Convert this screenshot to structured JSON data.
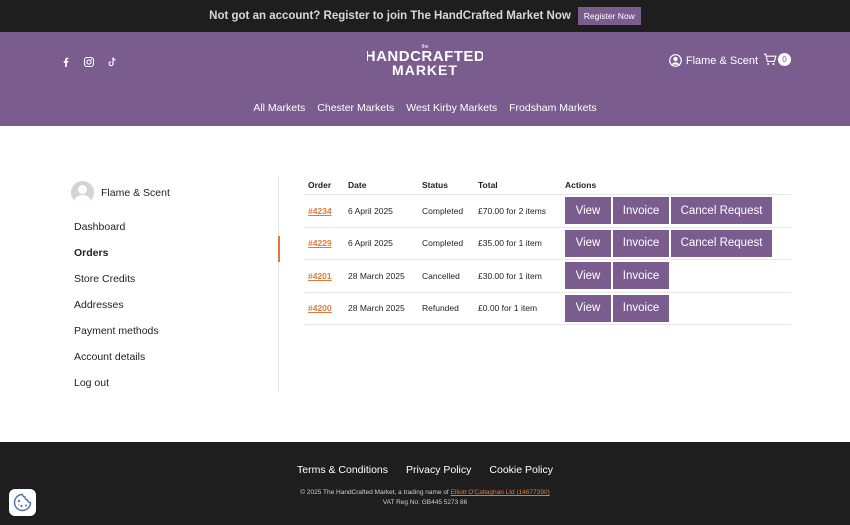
{
  "topbar": {
    "message": "Not got an account? Register to join The HandCrafted Market Now",
    "button": "Register Now"
  },
  "header": {
    "social_icons": [
      "facebook-icon",
      "instagram-icon",
      "tiktok-icon"
    ],
    "logo_alt": "The HandCrafted Market",
    "account_name": "Flame & Scent",
    "cart_count": "0",
    "nav": [
      "All Markets",
      "Chester Markets",
      "West Kirby Markets",
      "Frodsham Markets"
    ]
  },
  "sidebar": {
    "user_name": "Flame & Scent",
    "items": [
      "Dashboard",
      "Orders",
      "Store Credits",
      "Addresses",
      "Payment methods",
      "Account details",
      "Log out"
    ],
    "active": "Orders"
  },
  "orders": {
    "headers": [
      "Order",
      "Date",
      "Status",
      "Total",
      "Actions"
    ],
    "rows": [
      {
        "number": "#4234",
        "date": "6 April 2025",
        "status": "Completed",
        "total": "£70.00 for 2 items",
        "actions": [
          "View",
          "Invoice",
          "Cancel Request"
        ]
      },
      {
        "number": "#4229",
        "date": "6 April 2025",
        "status": "Completed",
        "total": "£35.00 for 1 item",
        "actions": [
          "View",
          "Invoice",
          "Cancel Request"
        ]
      },
      {
        "number": "#4201",
        "date": "28 March 2025",
        "status": "Cancelled",
        "total": "£30.00 for 1 item",
        "actions": [
          "View",
          "Invoice"
        ]
      },
      {
        "number": "#4200",
        "date": "28 March 2025",
        "status": "Refunded",
        "total": "£0.00 for 1 item",
        "actions": [
          "View",
          "Invoice"
        ]
      }
    ]
  },
  "footer": {
    "links": [
      "Terms & Conditions",
      "Privacy Policy",
      "Cookie Policy"
    ],
    "copyright_prefix": "© 2025 The HandCrafted Market, a trading name of",
    "company_link": "Elliott O'Callaghan Ltd (14677390)",
    "vat": "VAT Reg No: GB445 5273 86"
  },
  "colors": {
    "brand": "#7a5c8f",
    "accent": "#e07a3a",
    "dark": "#1e1e1e"
  }
}
